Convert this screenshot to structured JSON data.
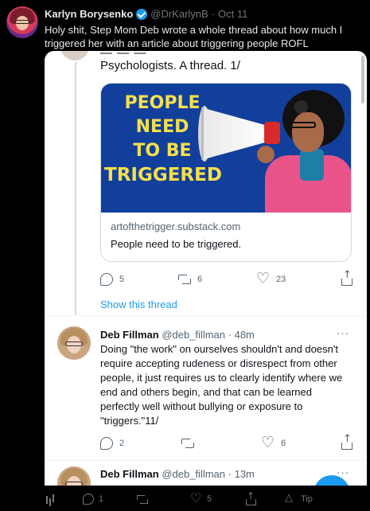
{
  "outer_tweet": {
    "author_name": "Karlyn Borysenko",
    "handle": "@DrKarlynB",
    "separator": "·",
    "date": "Oct 11",
    "text": "Holy shit, Step Mom Deb wrote a whole thread about how much I triggered her with an article about triggering people ROFL",
    "stats": {
      "replies": "1",
      "likes": "5",
      "tip_label": "Tip"
    }
  },
  "embedded": {
    "cut_line_top": "— — —",
    "first_tweet_text_end": "Psychologists. A thread. 1/",
    "link_card": {
      "image_headline_lines": [
        "PEOPLE",
        "NEED",
        "TO BE",
        "TRIGGERED"
      ],
      "domain": "artofthetrigger.substack.com",
      "title": "People need to be triggered."
    },
    "first_tweet_actions": {
      "replies": "5",
      "retweets": "6",
      "likes": "23"
    },
    "show_thread": "Show this thread",
    "second_tweet": {
      "author_name": "Deb Fillman",
      "handle": "@deb_fillman",
      "separator": "·",
      "time": "48m",
      "more": "···",
      "text": "Doing \"the work\" on ourselves shouldn't and doesn't require accepting rudeness or disrespect from other people, it just requires us to clearly identify where we end and others begin, and that can be learned perfectly well without bullying or exposure to \"triggers.\"11/",
      "actions": {
        "replies": "2",
        "likes": "6"
      }
    },
    "third_tweet": {
      "author_name": "Deb Fillman",
      "handle": "@deb_fillman",
      "separator": "·",
      "time": "13m",
      "more": "···"
    }
  },
  "colors": {
    "link_blue": "#1d9bf0",
    "card_bg": "#123f9c",
    "headline_yellow": "#f5e04a"
  },
  "icons": [
    "verified-badge-icon",
    "reply-icon",
    "retweet-icon",
    "like-icon",
    "share-icon",
    "stats-icon",
    "tip-icon",
    "more-icon"
  ]
}
